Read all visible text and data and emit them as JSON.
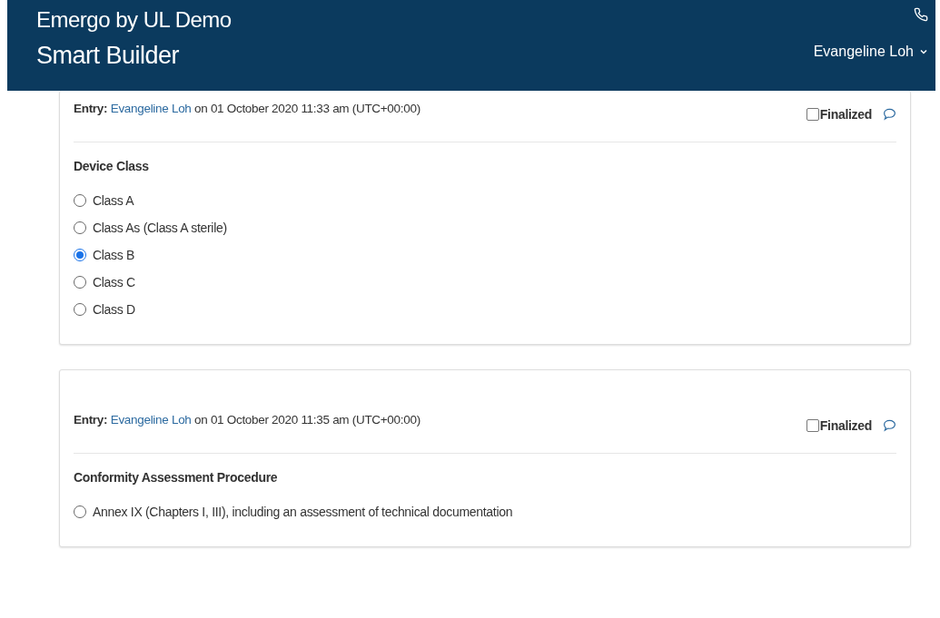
{
  "header": {
    "org": "Emergo by UL Demo",
    "app": "Smart Builder",
    "user": "Evangeline Loh"
  },
  "entries": [
    {
      "label": "Entry:",
      "author": "Evangeline Loh",
      "meta": "on 01 October 2020 11:33 am (UTC+00:00)",
      "finalized_label": "Finalized",
      "finalized": false,
      "question": "Device Class",
      "options": [
        {
          "label": "Class A",
          "selected": false
        },
        {
          "label": "Class As (Class A sterile)",
          "selected": false
        },
        {
          "label": "Class B",
          "selected": true
        },
        {
          "label": "Class C",
          "selected": false
        },
        {
          "label": "Class D",
          "selected": false
        }
      ]
    },
    {
      "label": "Entry:",
      "author": "Evangeline Loh",
      "meta": "on 01 October 2020 11:35 am (UTC+00:00)",
      "finalized_label": "Finalized",
      "finalized": false,
      "question": "Conformity Assessment Procedure",
      "options": [
        {
          "label": "Annex IX (Chapters I, III), including an assessment of technical documentation",
          "selected": false
        }
      ]
    }
  ]
}
